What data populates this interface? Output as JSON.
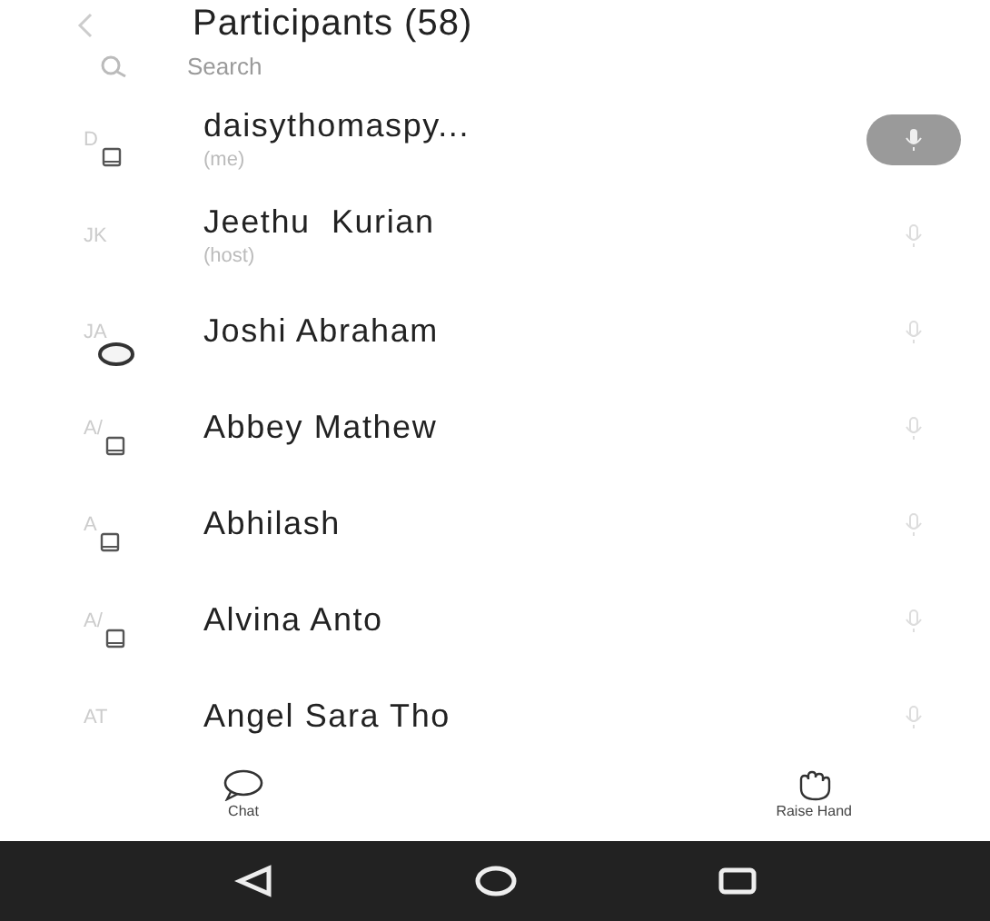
{
  "header": {
    "title": "Participants (58)"
  },
  "search": {
    "placeholder": "Search"
  },
  "participants": [
    {
      "initials": "D",
      "kind": "phone",
      "name": "daisythomaspy...",
      "role": "(me)",
      "mic_highlighted": true
    },
    {
      "initials": "JK",
      "kind": "plain",
      "name": "Jeethu  Kurian",
      "role": "(host)",
      "mic_highlighted": false
    },
    {
      "initials": "JA",
      "kind": "ring",
      "name": "Joshi Abraham",
      "mic_highlighted": false
    },
    {
      "initials": "A/",
      "kind": "phone",
      "name": "Abbey Mathew",
      "mic_highlighted": false
    },
    {
      "initials": "A",
      "kind": "phone",
      "name": "Abhilash",
      "mic_highlighted": false
    },
    {
      "initials": "A/",
      "kind": "phone",
      "name": "Alvina Anto",
      "mic_highlighted": false
    },
    {
      "initials": "AT",
      "kind": "plain",
      "name": "Angel Sara Tho",
      "mic_highlighted": false
    }
  ],
  "toolbar": [
    {
      "kind": "chat",
      "label": "Chat"
    },
    {
      "kind": "hand",
      "label": "Raise Hand"
    }
  ]
}
